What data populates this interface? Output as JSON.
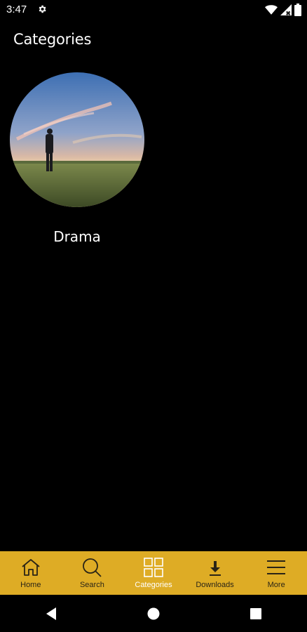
{
  "status_bar": {
    "time": "3:47",
    "icons": [
      "settings-gear-icon",
      "wifi-icon",
      "signal-icon",
      "battery-icon"
    ]
  },
  "page": {
    "title": "Categories"
  },
  "categories": [
    {
      "label": "Drama",
      "image": "person standing in a wheat field at sunset"
    }
  ],
  "bottom_nav": {
    "background": "#deac25",
    "items": [
      {
        "label": "Home",
        "icon": "home-icon",
        "active": false
      },
      {
        "label": "Search",
        "icon": "search-icon",
        "active": false
      },
      {
        "label": "Categories",
        "icon": "grid-icon",
        "active": true
      },
      {
        "label": "Downloads",
        "icon": "download-icon",
        "active": false
      },
      {
        "label": "More",
        "icon": "menu-icon",
        "active": false
      }
    ]
  },
  "system_nav": {
    "icons": [
      "back-icon",
      "home-circle-icon",
      "recents-icon"
    ]
  }
}
